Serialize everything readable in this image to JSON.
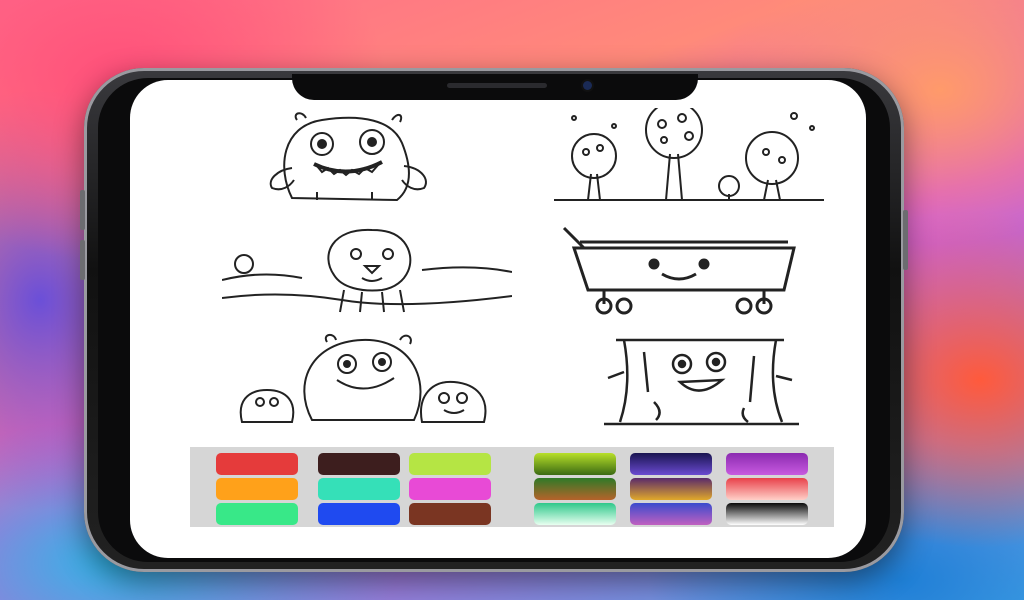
{
  "coloring_pages": [
    {
      "name": "monster",
      "icon": "monster-outline-icon"
    },
    {
      "name": "trees",
      "icon": "trees-outline-icon"
    },
    {
      "name": "lion",
      "icon": "lion-outline-icon"
    },
    {
      "name": "shopping-cart",
      "icon": "cart-outline-icon"
    },
    {
      "name": "monster-family",
      "icon": "monster-family-outline-icon"
    },
    {
      "name": "tree-stump",
      "icon": "stump-outline-icon"
    }
  ],
  "palette": {
    "solid": [
      [
        "#e53b3b",
        "#3d1e1e",
        "#b5e544"
      ],
      [
        "#ffa11a",
        "#35e0b8",
        "#e84ad6"
      ],
      [
        "#38e888",
        "#1f4af0",
        "#7a3522"
      ]
    ],
    "gradient": [
      [
        [
          "#b8e02a",
          "#3b6a14"
        ],
        [
          "#1a1550",
          "#6a4ad0"
        ],
        [
          "#8b2bb0",
          "#c85ae0"
        ]
      ],
      [
        [
          "#2f7a28",
          "#b5632a"
        ],
        [
          "#5a2a6a",
          "#e0a82a"
        ],
        [
          "#e8414a",
          "#ffd0c8"
        ]
      ],
      [
        [
          "#2ec88a",
          "#e8fff0"
        ],
        [
          "#3a4acd",
          "#c060c0"
        ],
        [
          "#0a0a0a",
          "#ffffff"
        ]
      ]
    ]
  }
}
